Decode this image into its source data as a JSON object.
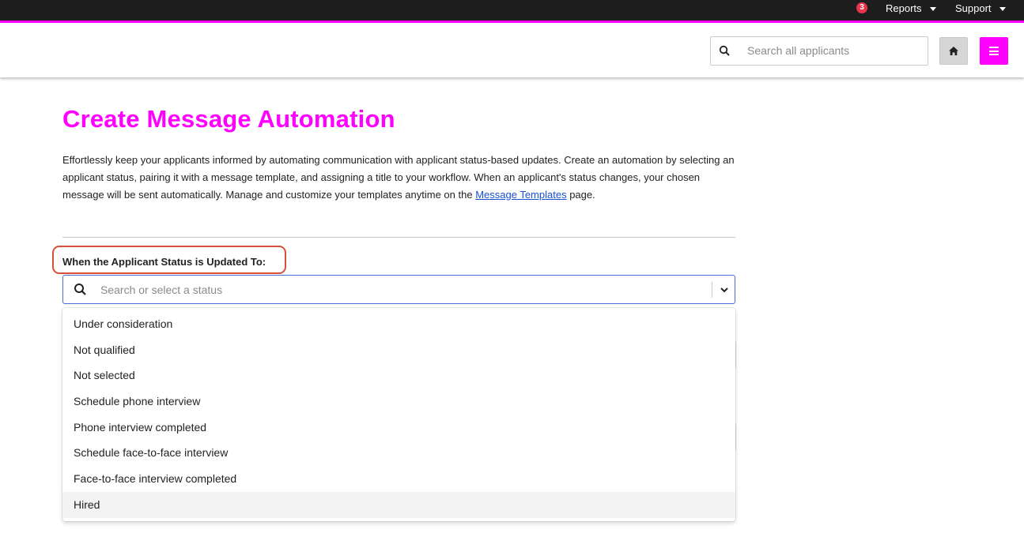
{
  "topbar": {
    "notification_count": "3",
    "reports_label": "Reports",
    "support_label": "Support"
  },
  "header": {
    "search_placeholder": "Search all applicants"
  },
  "page": {
    "title": "Create Message Automation",
    "description_before_link": "Effortlessly keep your applicants informed by automating communication with applicant status-based updates. Create an automation by selecting an applicant status, pairing it with a message template, and assigning a title to your workflow. When an applicant's status changes, your chosen message will be sent automatically. Manage and customize your templates anytime on the ",
    "description_link": "Message Templates",
    "description_after_link": " page."
  },
  "status_field": {
    "label": "When the Applicant Status is Updated To:",
    "placeholder": "Search or select a status",
    "options": [
      "Under consideration",
      "Not qualified",
      "Not selected",
      "Schedule phone interview",
      "Phone interview completed",
      "Schedule face-to-face interview",
      "Face-to-face interview completed",
      "Hired"
    ],
    "hovered_option": "Hired"
  },
  "colors": {
    "brand": "#ff00ff",
    "topbar": "#1d1d1d",
    "badge": "#e8334a",
    "highlight": "#d9503a",
    "link": "#1a4fd6"
  },
  "icons": [
    "search-icon",
    "home-icon",
    "hamburger-menu-icon",
    "chevron-down-icon",
    "caret-down-icon"
  ]
}
